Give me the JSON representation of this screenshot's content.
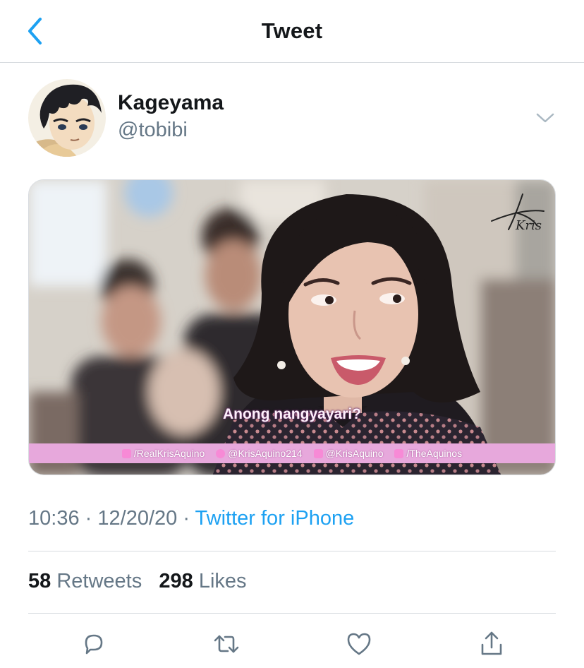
{
  "header": {
    "back_icon": "chevron-left-icon",
    "title": "Tweet",
    "accent": "#1da1f2"
  },
  "tweet": {
    "author": {
      "display_name": "Kageyama",
      "handle": "@tobibi",
      "avatar": "anime-character-avatar"
    },
    "caret_icon": "chevron-down-icon",
    "media": {
      "signature": "Kris",
      "subtitle": "Anong nangyayari?",
      "social_handles": [
        {
          "icon": "facebook-icon",
          "text": "/RealKrisAquino"
        },
        {
          "icon": "twitter-icon",
          "text": "@KrisAquino214"
        },
        {
          "icon": "instagram-icon",
          "text": "@KrisAquino"
        },
        {
          "icon": "youtube-icon",
          "text": "/TheAquinos"
        }
      ],
      "bar_color": "#e7a8dc"
    },
    "time": "10:36",
    "separator": "·",
    "date": "12/20/20",
    "source": "Twitter for iPhone",
    "stats": {
      "retweets_count": "58",
      "retweets_label": "Retweets",
      "likes_count": "298",
      "likes_label": "Likes"
    },
    "actions": [
      "reply-icon",
      "retweet-icon",
      "like-icon",
      "share-icon"
    ]
  }
}
